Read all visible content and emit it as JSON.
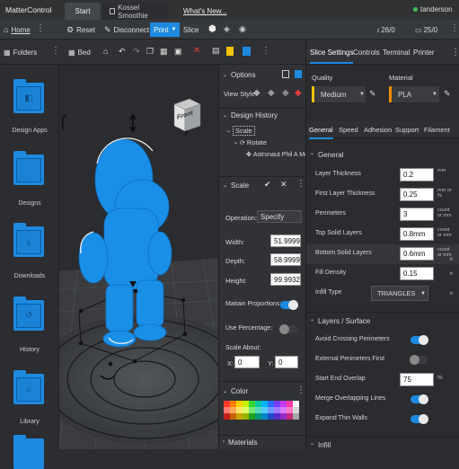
{
  "app": {
    "title": "MatterControl",
    "user": "tanderson"
  },
  "tabs": [
    {
      "label": "Start"
    },
    {
      "label": "Kossel Smoothie"
    },
    {
      "label": "What's New..."
    }
  ],
  "toolbar": {
    "home": "Home",
    "reset": "Reset",
    "disconnect": "Disconnect",
    "print": "Print",
    "slice": "Slice",
    "temp1": "26/0",
    "temp2": "25/0",
    "bed": "Bed"
  },
  "library": {
    "header": "Folders",
    "folders": [
      "Design Apps",
      "Designs",
      "Downloads",
      "History",
      "Library"
    ]
  },
  "viewcube": {
    "label": "Front"
  },
  "options": {
    "header": "Options",
    "view_style_label": "View Style"
  },
  "design_history": {
    "header": "Design History",
    "items": [
      "Scale",
      "Rotate",
      "Astronaut Phil A Me"
    ]
  },
  "scale_panel": {
    "header": "Scale",
    "operation_label": "Operation:",
    "operation_value": "Specify",
    "width_label": "Width:",
    "width_value": "51.9999",
    "depth_label": "Depth:",
    "depth_value": "58.9999",
    "height_label": "Height:",
    "height_value": "99.9932",
    "maintain_label": "Maitain Proportions:",
    "use_percent_label": "Use Percentage:",
    "scale_about_label": "Scale About:",
    "x_label": "X:",
    "x_value": "0",
    "y_label": "Y:",
    "y_value": "0"
  },
  "color_panel": {
    "header": "Color",
    "swatches": [
      "#ff3b30",
      "#ff8000",
      "#ffd200",
      "#c8f000",
      "#33d633",
      "#00c8a0",
      "#00b4ff",
      "#2d6cff",
      "#7a3cff",
      "#c23cff",
      "#ff3ca8",
      "#ffffff",
      "#ff7a70",
      "#ffaa55",
      "#ffe566",
      "#dcff66",
      "#77e877",
      "#55dcc0",
      "#55ccff",
      "#6d98ff",
      "#a57aff",
      "#d87aff",
      "#ff7ac4",
      "#d8d8d8",
      "#c42020",
      "#c86400",
      "#c8a400",
      "#96b400",
      "#20a020",
      "#009a7a",
      "#0088c8",
      "#1f4cc8",
      "#5a28c8",
      "#9428c8",
      "#c8287c",
      "#a8a8a8"
    ]
  },
  "materials_panel": {
    "header": "Materials"
  },
  "slice_tabs": [
    "Slice Settings",
    "Controls",
    "Terminal",
    "Printer"
  ],
  "quality": {
    "label": "Quality",
    "value": "Medium",
    "color": "#f2c200"
  },
  "material": {
    "label": "Material",
    "value": "PLA",
    "color": "#f28c00"
  },
  "settings_tabs": [
    "General",
    "Speed",
    "Adhesion",
    "Support",
    "Filament"
  ],
  "general": {
    "header": "General",
    "rows": [
      {
        "label": "Layer Thickness",
        "value": "0.2",
        "unit": "mm"
      },
      {
        "label": "First Layer Thickness",
        "value": "0.25",
        "unit": "mm or %"
      },
      {
        "label": "Perimeters",
        "value": "3",
        "unit": "count or mm"
      },
      {
        "label": "Top Solid Layers",
        "value": "0.8mm",
        "unit": "count or mm"
      },
      {
        "label": "Bottom Solid Layers",
        "value": "0.6mm",
        "unit": "count or mm"
      },
      {
        "label": "Fill Density",
        "value": "0.15",
        "unit": ""
      },
      {
        "label": "Infill Type",
        "value": "TRIANGLES",
        "unit": ""
      }
    ]
  },
  "layers": {
    "header": "Layers / Surface",
    "rows": [
      {
        "label": "Avoid Crossing Perimeters",
        "on": true
      },
      {
        "label": "External Perimeters First",
        "on": false
      },
      {
        "label": "Start End Overlap",
        "value": "75",
        "unit": "%"
      },
      {
        "label": "Merge Overlapping Lines",
        "on": true
      },
      {
        "label": "Expand Thin Walls",
        "on": true
      }
    ]
  },
  "infill_header": "Infill",
  "colors": {
    "accent": "#1d8ae0",
    "model": "#1a8fe8"
  }
}
